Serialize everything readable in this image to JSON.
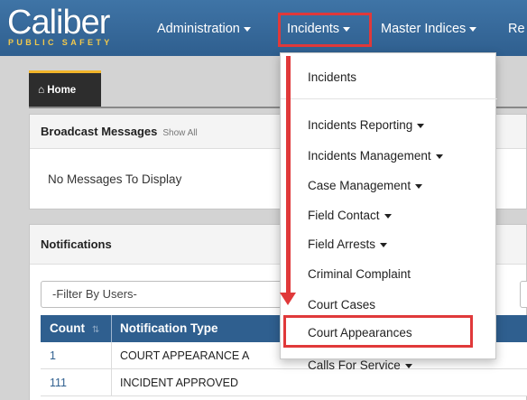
{
  "brand": {
    "name": "Caliber",
    "tagline": "PUBLIC SAFETY"
  },
  "nav": {
    "items": [
      {
        "label": "Administration"
      },
      {
        "label": "Incidents"
      },
      {
        "label": "Master Indices"
      },
      {
        "label": "Re"
      }
    ],
    "highlight_color": "#e0393a"
  },
  "tabs": {
    "home_label": "Home"
  },
  "broadcast": {
    "title": "Broadcast Messages",
    "show_all": "Show All",
    "empty_message": "No Messages To Display"
  },
  "notifications": {
    "title": "Notifications",
    "filter_placeholder": "-Filter By Users-",
    "columns": [
      "Count",
      "Notification Type"
    ],
    "rows": [
      {
        "count": "1",
        "type": "COURT APPEARANCE A"
      },
      {
        "count": "111",
        "type": "INCIDENT APPROVED"
      }
    ]
  },
  "incidents_menu": {
    "items": [
      {
        "label": "Incidents",
        "has_submenu": false
      },
      {
        "label": "Incidents Reporting",
        "has_submenu": true
      },
      {
        "label": "Incidents Management",
        "has_submenu": true
      },
      {
        "label": "Case Management",
        "has_submenu": true
      },
      {
        "label": "Field Contact",
        "has_submenu": true
      },
      {
        "label": "Field Arrests",
        "has_submenu": true
      },
      {
        "label": "Criminal Complaint",
        "has_submenu": false
      },
      {
        "label": "Court Cases",
        "has_submenu": false
      },
      {
        "label": "Court Appearances",
        "has_submenu": false
      },
      {
        "label": "Calls For Service",
        "has_submenu": true
      }
    ],
    "highlighted_item": "Court Appearances"
  },
  "colors": {
    "navbar": "#2f5f8f",
    "accent": "#f0b429",
    "annotation": "#e0393a"
  }
}
